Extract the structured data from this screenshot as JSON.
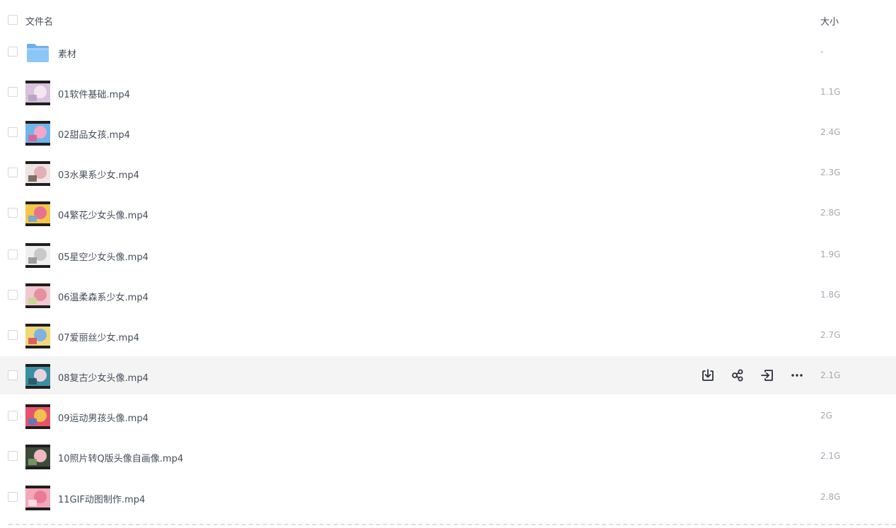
{
  "header": {
    "name_label": "文件名",
    "size_label": "大小"
  },
  "files": [
    {
      "name": "素材",
      "size": "-",
      "type": "folder"
    },
    {
      "name": "01软件基础.mp4",
      "size": "1.1G",
      "type": "video",
      "colors": [
        "#d8c2dc",
        "#f3e6f0",
        "#b79fc3"
      ]
    },
    {
      "name": "02甜品女孩.mp4",
      "size": "2.4G",
      "type": "video",
      "colors": [
        "#6fb5e8",
        "#f2a6c8",
        "#e65c8e"
      ]
    },
    {
      "name": "03水果系少女.mp4",
      "size": "2.3G",
      "type": "video",
      "colors": [
        "#f1e3e3",
        "#e3b0b8",
        "#6b5b4f"
      ]
    },
    {
      "name": "04繁花少女头像.mp4",
      "size": "2.8G",
      "type": "video",
      "colors": [
        "#f4c64a",
        "#e7728f",
        "#6aa4d6"
      ]
    },
    {
      "name": "05星空少女头像.mp4",
      "size": "1.9G",
      "type": "video",
      "colors": [
        "#efefef",
        "#c9c9c9",
        "#8f8f8f"
      ]
    },
    {
      "name": "06温柔森系少女.mp4",
      "size": "1.8G",
      "type": "video",
      "colors": [
        "#f2c8cf",
        "#e58fa0",
        "#bcd98a"
      ]
    },
    {
      "name": "07爱丽丝少女.mp4",
      "size": "2.7G",
      "type": "video",
      "colors": [
        "#f0d77a",
        "#7fb2e3",
        "#d94b5c"
      ]
    },
    {
      "name": "08复古少女头像.mp4",
      "size": "2.1G",
      "type": "video",
      "hover": true,
      "colors": [
        "#3b8fa3",
        "#e8d3dd",
        "#2b5361"
      ]
    },
    {
      "name": "09运动男孩头像.mp4",
      "size": "2G",
      "type": "video",
      "colors": [
        "#e8536b",
        "#f2c14e",
        "#4f7cc4"
      ]
    },
    {
      "name": "10照片转Q版头像自画像.mp4",
      "size": "2.1G",
      "type": "video",
      "colors": [
        "#3e4a3a",
        "#f0b8c4",
        "#7fa06a"
      ]
    },
    {
      "name": "11GIF动图制作.mp4",
      "size": "2.8G",
      "type": "video",
      "colors": [
        "#f5a6b9",
        "#e97b95",
        "#fde6ec"
      ]
    }
  ],
  "row_actions": [
    {
      "name": "download-icon"
    },
    {
      "name": "share-icon"
    },
    {
      "name": "move-icon"
    },
    {
      "name": "more-icon"
    }
  ]
}
